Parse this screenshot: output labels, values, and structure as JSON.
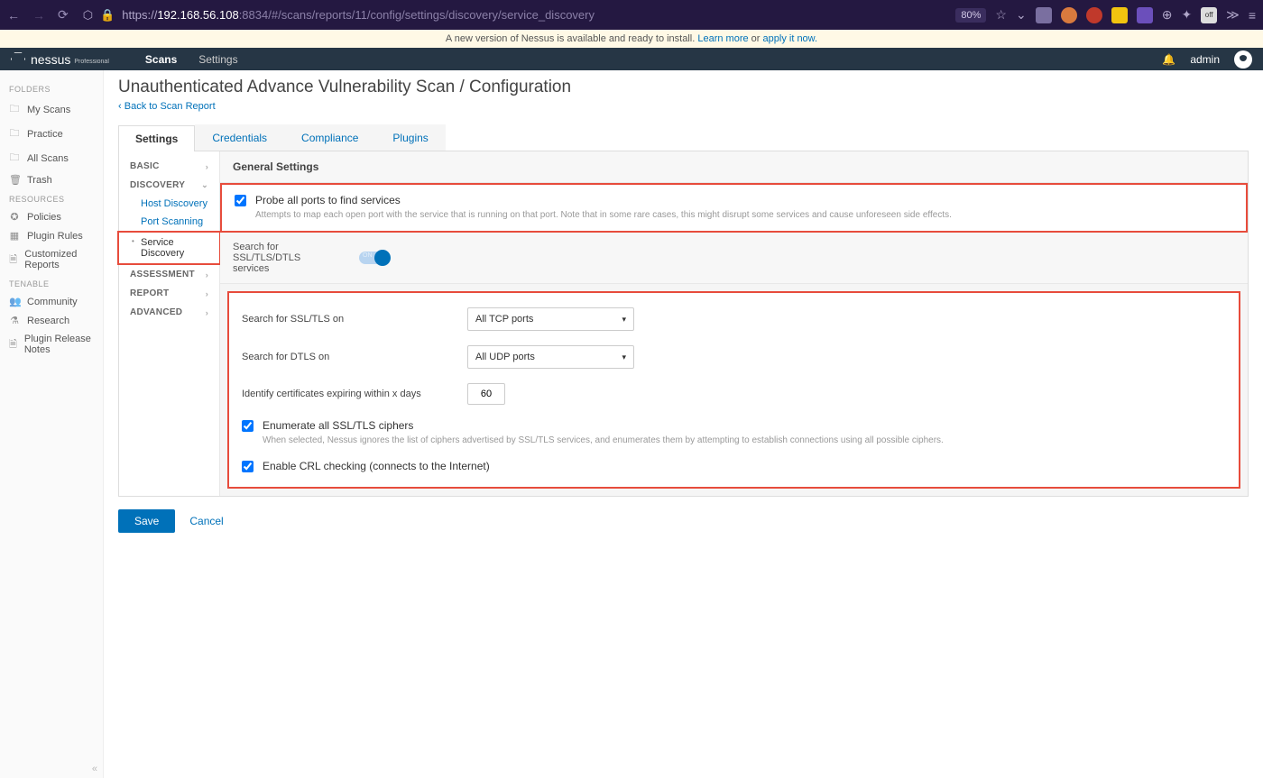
{
  "browser": {
    "url_prefix": "https://",
    "url_host": "192.168.56.108",
    "url_port": ":8834",
    "url_path": "/#/scans/reports/11/config/settings/discovery/service_discovery",
    "zoom": "80%"
  },
  "notice": {
    "text_a": "A new version of Nessus is available and ready to install. ",
    "learn": "Learn more",
    "or": " or ",
    "apply": "apply it now."
  },
  "header": {
    "product": "nessus",
    "edition": "Professional",
    "nav": {
      "scans": "Scans",
      "settings": "Settings"
    },
    "user": "admin"
  },
  "sidebar": {
    "groups": {
      "folders": "FOLDERS",
      "resources": "RESOURCES",
      "tenable": "TENABLE"
    },
    "items": {
      "my_scans": "My Scans",
      "practice": "Practice",
      "all_scans": "All Scans",
      "trash": "Trash",
      "policies": "Policies",
      "plugin_rules": "Plugin Rules",
      "customized_reports": "Customized Reports",
      "community": "Community",
      "research": "Research",
      "plugin_release_notes": "Plugin Release Notes"
    }
  },
  "page": {
    "title": "Unauthenticated Advance Vulnerability Scan / Configuration",
    "back": "Back to Scan Report"
  },
  "tabs": {
    "settings": "Settings",
    "credentials": "Credentials",
    "compliance": "Compliance",
    "plugins": "Plugins"
  },
  "confignav": {
    "basic": "BASIC",
    "discovery": "DISCOVERY",
    "host_discovery": "Host Discovery",
    "port_scanning": "Port Scanning",
    "service_discovery": "Service Discovery",
    "assessment": "ASSESSMENT",
    "report": "REPORT",
    "advanced": "ADVANCED"
  },
  "panel": {
    "general": "General Settings",
    "probe_label": "Probe all ports to find services",
    "probe_desc": "Attempts to map each open port with the service that is running on that port. Note that in some rare cases, this might disrupt some services and cause unforeseen side effects.",
    "ssl_toggle_label": "Search for SSL/TLS/DTLS services",
    "ssl_on_label": "Search for SSL/TLS on",
    "ssl_on_value": "All TCP ports",
    "dtls_on_label": "Search for DTLS on",
    "dtls_on_value": "All UDP ports",
    "cert_expire_label": "Identify certificates expiring within x days",
    "cert_expire_value": "60",
    "enum_label": "Enumerate all SSL/TLS ciphers",
    "enum_desc": "When selected, Nessus ignores the list of ciphers advertised by SSL/TLS services, and enumerates them by attempting to establish connections using all possible ciphers.",
    "crl_label": "Enable CRL checking (connects to the Internet)",
    "switch_on": "ON"
  },
  "actions": {
    "save": "Save",
    "cancel": "Cancel"
  }
}
